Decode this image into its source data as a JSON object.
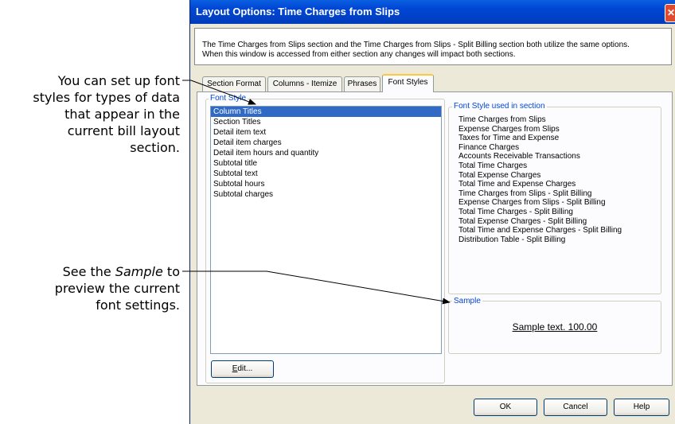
{
  "callouts": {
    "font_styles": {
      "lines": [
        "You can set up font",
        "styles for types of data",
        "that appear in the",
        "current bill layout",
        "section."
      ]
    },
    "sample": {
      "line1_pre": "See the ",
      "line1_em": "Sample",
      "line1_post": " to",
      "line2": "preview the current",
      "line3": "font settings."
    }
  },
  "window": {
    "title": "Layout Options: Time Charges from Slips",
    "description": [
      "The Time Charges from Slips section and the Time Charges from Slips - Split Billing section both utilize the same options.",
      "When this window is accessed from either section any changes will impact both sections."
    ],
    "tabs": [
      {
        "label": "Section Format",
        "active": false
      },
      {
        "label": "Columns - Itemize",
        "active": false
      },
      {
        "label": "Phrases",
        "active": false
      },
      {
        "label": "Font Styles",
        "active": true
      }
    ],
    "font_style_group": {
      "label": "Font Style",
      "items": [
        "Column Titles",
        "Section Titles",
        "Detail item text",
        "Detail item charges",
        "Detail item hours and quantity",
        "Subtotal title",
        "Subtotal text",
        "Subtotal hours",
        "Subtotal charges"
      ],
      "selected_index": 0
    },
    "used_group": {
      "label": "Font Style used in section",
      "items": [
        "Time Charges from Slips",
        "Expense Charges from Slips",
        "Taxes for Time and Expense",
        "Finance Charges",
        "Accounts Receivable Transactions",
        "Total Time Charges",
        "Total Expense Charges",
        "Total Time and Expense Charges",
        "Time Charges from Slips - Split Billing",
        "Expense Charges from Slips - Split Billing",
        "Total Time Charges - Split Billing",
        "Total Expense Charges - Split Billing",
        "Total Time and Expense Charges - Split Billing",
        "Distribution Table - Split Billing"
      ]
    },
    "sample_group": {
      "label": "Sample",
      "text": "Sample text. 100.00"
    },
    "buttons": {
      "edit": "Edit...",
      "ok": "OK",
      "cancel": "Cancel",
      "help": "Help"
    }
  }
}
